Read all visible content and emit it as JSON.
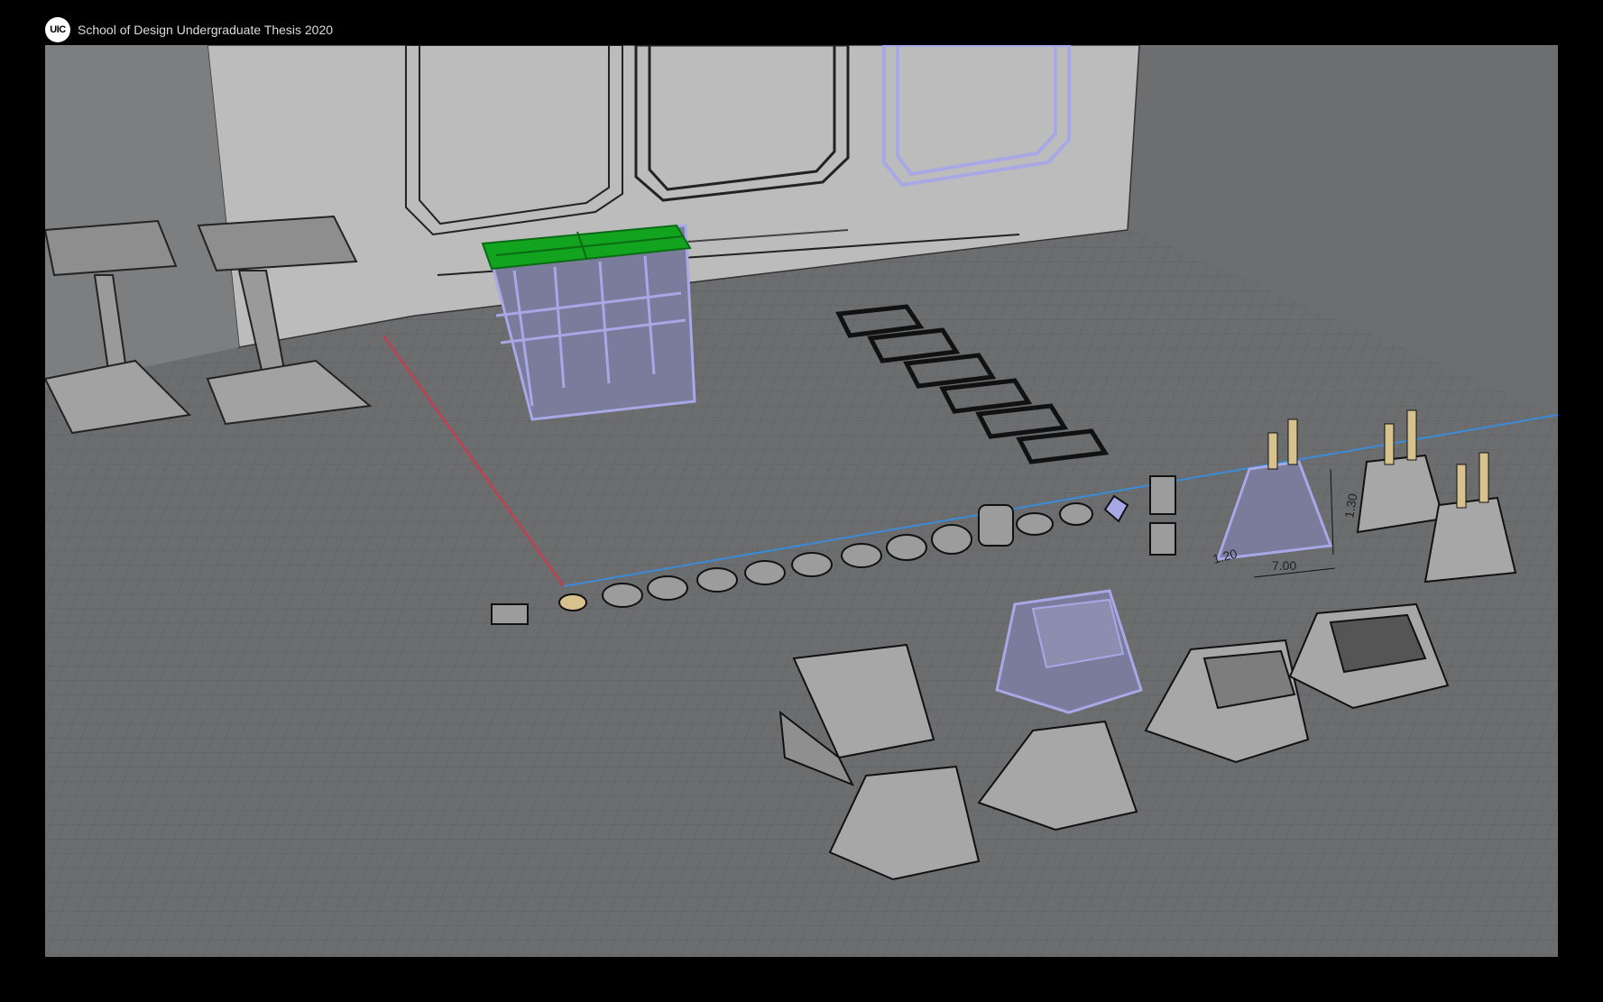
{
  "header": {
    "logo_text": "UIC",
    "title": "School of Design Undergraduate Thesis 2020"
  },
  "viewport": {
    "dimension_labels": [
      "7.00",
      "1.20",
      "1.30"
    ]
  },
  "colors": {
    "background": "#000000",
    "floor": "#6c6d6f",
    "grid_line": "#5a5b5d",
    "wall": "#bfbfbf",
    "selection": "#a8a8e6",
    "selected_fill": "#7b7b9c",
    "selected_top": "#12a31f",
    "object_fill": "#a7a7a7",
    "x_axis": "#d6344a",
    "y_axis": "#3a8bd9",
    "brass": "#d7c28e"
  }
}
